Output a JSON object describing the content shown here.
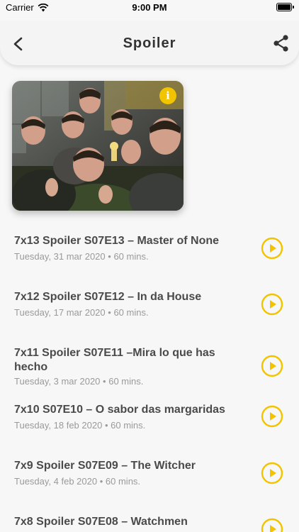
{
  "status_bar": {
    "carrier": "Carrier",
    "time": "9:00 PM"
  },
  "nav": {
    "title": "Spoiler"
  },
  "colors": {
    "accent": "#f2c400",
    "title_text": "#4a4a4a",
    "meta_text": "#9a9a9a"
  },
  "cover": {
    "info_glyph": "i"
  },
  "episodes": [
    {
      "title": "7x13 Spoiler S07E13 – Master of None",
      "date": "Tuesday, 31 mar 2020",
      "duration": "60 mins."
    },
    {
      "title": "7x12 Spoiler S07E12 – In da House",
      "date": "Tuesday, 17 mar 2020",
      "duration": "60 mins."
    },
    {
      "title": "7x11 Spoiler S07E11 –Mira lo que has hecho",
      "date": "Tuesday, 3 mar 2020",
      "duration": "60 mins."
    },
    {
      "title": "7x10 S07E10 – O sabor das margaridas",
      "date": "Tuesday, 18 feb 2020",
      "duration": "60 mins."
    },
    {
      "title": "7x9 Spoiler S07E09 – The Witcher",
      "date": "Tuesday, 4 feb 2020",
      "duration": "60 mins."
    },
    {
      "title": "7x8 Spoiler S07E08 – Watchmen",
      "date": "",
      "duration": ""
    }
  ],
  "meta_separator": "•"
}
